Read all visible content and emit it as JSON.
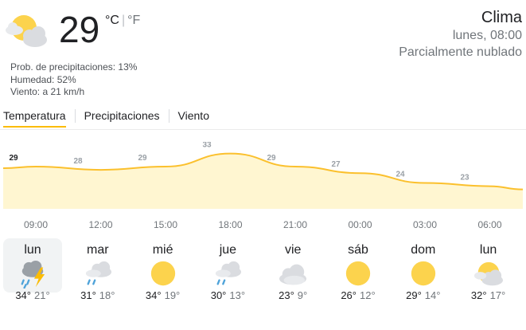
{
  "current": {
    "icon": "partly-cloudy-icon",
    "temperature": "29",
    "unit_c": "°C",
    "unit_f": "°F",
    "precip": "Prob. de precipitaciones: 13%",
    "humidity": "Humedad: 52%",
    "wind": "Viento: a 21 km/h"
  },
  "header": {
    "title": "Clima",
    "datetime": "lunes, 08:00",
    "condition": "Parcialmente nublado"
  },
  "tabs": [
    {
      "label": "Temperatura",
      "active": true
    },
    {
      "label": "Precipitaciones",
      "active": false
    },
    {
      "label": "Viento",
      "active": false
    }
  ],
  "chart_data": {
    "type": "area",
    "x": [
      "09:00",
      "12:00",
      "15:00",
      "18:00",
      "21:00",
      "00:00",
      "03:00",
      "06:00"
    ],
    "series": [
      {
        "values": [
          29,
          28,
          29,
          33,
          29,
          27,
          24,
          23
        ]
      }
    ],
    "line_color": "#fbc02d",
    "fill_color": "#fff6d1"
  },
  "days": [
    {
      "name": "lun",
      "icon": "thunderstorm-icon",
      "high": "34°",
      "low": "21°",
      "selected": true
    },
    {
      "name": "mar",
      "icon": "showers-icon",
      "high": "31°",
      "low": "18°",
      "selected": false
    },
    {
      "name": "mié",
      "icon": "sunny-icon",
      "high": "34°",
      "low": "19°",
      "selected": false
    },
    {
      "name": "jue",
      "icon": "showers-icon",
      "high": "30°",
      "low": "13°",
      "selected": false
    },
    {
      "name": "vie",
      "icon": "cloudy-icon",
      "high": "23°",
      "low": "9°",
      "selected": false
    },
    {
      "name": "sáb",
      "icon": "sunny-icon",
      "high": "26°",
      "low": "12°",
      "selected": false
    },
    {
      "name": "dom",
      "icon": "sunny-icon",
      "high": "29°",
      "low": "14°",
      "selected": false
    },
    {
      "name": "lun",
      "icon": "partly-cloudy-icon",
      "high": "32°",
      "low": "17°",
      "selected": false
    }
  ]
}
